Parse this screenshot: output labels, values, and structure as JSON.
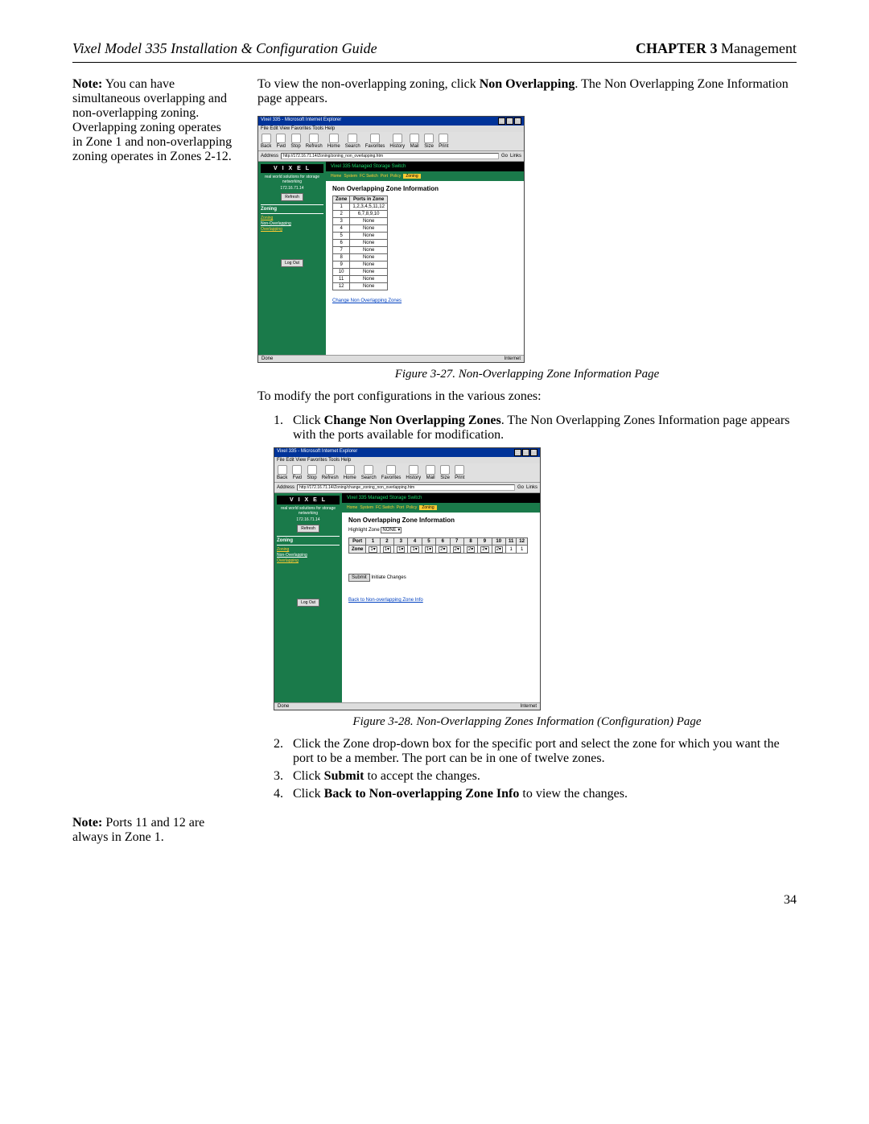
{
  "header": {
    "left": "Vixel Model 335 Installation & Configuration Guide",
    "chapter_label": "CHAPTER 3",
    "chapter_title": " Management"
  },
  "sidenote1": {
    "prefix": "Note:",
    "body": " You can have simultaneous overlapping and non-overlapping zoning. Overlapping zoning operates in Zone 1 and non-overlapping zoning operates in Zones 2-12."
  },
  "sidenote2": {
    "prefix": "Note:",
    "body": " Ports 11 and 12 are always in Zone 1."
  },
  "intro_para": {
    "pre": "To view the non-overlapping zoning, click ",
    "bold": "Non Overlapping",
    "post": ". The Non Overlapping Zone Information page appears."
  },
  "fig27": {
    "caption": "Figure 3-27. Non-Overlapping Zone Information Page",
    "browser_title": "Vixel 335 - Microsoft Internet Explorer",
    "menu_items": "File  Edit  View  Favorites  Tools  Help",
    "toolbar": [
      "Back",
      "Fwd",
      "Stop",
      "Refresh",
      "Home",
      "Search",
      "Favorites",
      "History",
      "Mail",
      "Size",
      "Print"
    ],
    "address_label": "Address",
    "address_url": "http://172.16.71.14/Zoning/zoning_non_overlapping.htm",
    "go_label": "Go",
    "links_label": "Links",
    "vixel_logo": "V I X E L",
    "vixel_sub": "real world solutions for storage networking",
    "ip": "172.16.71.14",
    "refresh_btn": "Refresh",
    "zoning_h": "Zoning",
    "nav_items": [
      "Zoning",
      "Non-Overlapping",
      "Overlapping"
    ],
    "logout": "Log Out",
    "band": "Vixel 335 Managed Storage Switch",
    "tabs": [
      "Home",
      "System",
      "FC Switch",
      "Port",
      "Policy",
      "Zoning"
    ],
    "content_h": "Non Overlapping Zone Information",
    "table_h": [
      "Zone",
      "Ports in Zone"
    ],
    "rows": [
      [
        "1",
        "1,2,3,4,5,11,12"
      ],
      [
        "2",
        "6,7,8,9,10"
      ],
      [
        "3",
        "None"
      ],
      [
        "4",
        "None"
      ],
      [
        "5",
        "None"
      ],
      [
        "6",
        "None"
      ],
      [
        "7",
        "None"
      ],
      [
        "8",
        "None"
      ],
      [
        "9",
        "None"
      ],
      [
        "10",
        "None"
      ],
      [
        "11",
        "None"
      ],
      [
        "12",
        "None"
      ]
    ],
    "change_link": "Change Non Overlapping Zones",
    "status_done": "Done",
    "status_net": "Internet"
  },
  "after27": "To modify the port configurations in the various zones:",
  "step1": {
    "num": "1.",
    "pre": "Click ",
    "bold": "Change Non Overlapping Zones",
    "post": ". The Non Overlapping Zones Information page appears with the ports available for modification."
  },
  "fig28": {
    "caption": "Figure 3-28. Non-Overlapping Zones Information (Configuration) Page",
    "address_url": "http://172.16.71.14/Zoning/change_zoning_non_overlapping.htm",
    "content_h": "Non Overlapping Zone Information",
    "highlight_label": "Highlight Zone",
    "highlight_val": "NONE",
    "port_label": "Port",
    "ports": [
      "1",
      "2",
      "3",
      "4",
      "5",
      "6",
      "7",
      "8",
      "9",
      "10",
      "11",
      "12"
    ],
    "zone_label": "Zone",
    "zone_vals": [
      "1",
      "1",
      "1",
      "1",
      "1",
      "2",
      "2",
      "2",
      "2",
      "2",
      "1",
      "1"
    ],
    "submit": "Submit",
    "initiate": "Initiate Changes",
    "back_link": "Back to Non-overlapping Zone Info"
  },
  "step2": {
    "num": "2.",
    "text": "Click the Zone drop-down box for the specific port and select the zone for which you want the port to be a member. The port can be in one of twelve zones."
  },
  "step3": {
    "num": "3.",
    "pre": "Click ",
    "bold": "Submit",
    "post": " to accept the changes."
  },
  "step4": {
    "num": "4.",
    "pre": "Click ",
    "bold": "Back to Non-overlapping Zone Info",
    "post": " to view the changes."
  },
  "page_number": "34"
}
